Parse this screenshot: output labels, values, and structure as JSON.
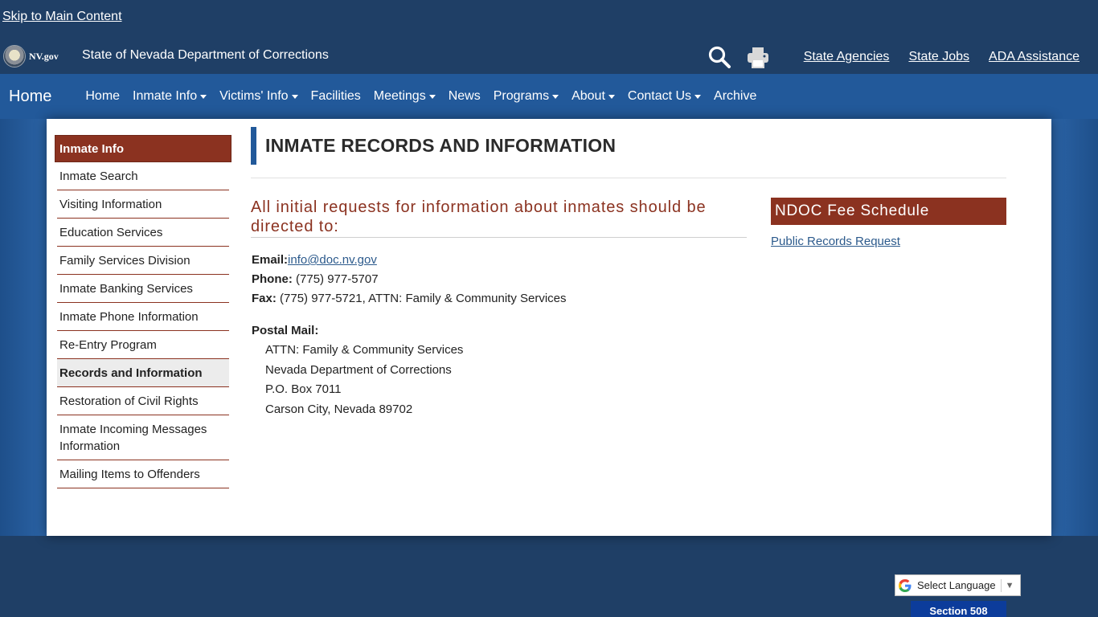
{
  "skip_link": "Skip to Main Content",
  "header": {
    "nvgov": "NV.gov",
    "agency": "State of Nevada Department of Corrections",
    "links": [
      "State Agencies",
      "State Jobs",
      "ADA Assistance"
    ]
  },
  "nav": {
    "brand": "Home",
    "items": [
      {
        "label": "Home",
        "dropdown": false
      },
      {
        "label": "Inmate Info",
        "dropdown": true
      },
      {
        "label": "Victims' Info",
        "dropdown": true
      },
      {
        "label": "Facilities",
        "dropdown": false
      },
      {
        "label": "Meetings",
        "dropdown": true
      },
      {
        "label": "News",
        "dropdown": false
      },
      {
        "label": "Programs",
        "dropdown": true
      },
      {
        "label": "About",
        "dropdown": true
      },
      {
        "label": "Contact Us",
        "dropdown": true
      },
      {
        "label": "Archive",
        "dropdown": false
      }
    ]
  },
  "sidebar": {
    "heading": "Inmate Info",
    "items": [
      "Inmate Search",
      "Visiting Information",
      "Education Services",
      "Family Services Division",
      "Inmate Banking Services",
      "Inmate Phone Information",
      "Re-Entry Program",
      "Records and Information",
      "Restoration of Civil Rights",
      "Inmate Incoming Messages Information",
      "Mailing Items to Offenders"
    ],
    "active_index": 7
  },
  "main": {
    "title": "INMATE RECORDS AND INFORMATION",
    "lead": "All initial requests for information about inmates should be directed to:",
    "email_label": "Email:",
    "email": "info@doc.nv.gov",
    "phone_label": "Phone:",
    "phone": " (775) 977-5707",
    "fax_label": "Fax:",
    "fax": " (775) 977-5721, ATTN: Family & Community Services",
    "postal_label": "Postal Mail:",
    "postal_lines": [
      "ATTN: Family & Community Services",
      "Nevada Department of Corrections",
      "P.O. Box 7011",
      "Carson City, Nevada 89702"
    ]
  },
  "aside": {
    "heading": "NDOC Fee Schedule",
    "link": "Public Records Request"
  },
  "footer": {
    "language": "Select Language",
    "section508": "Section 508"
  },
  "colors": {
    "header_bg": "#1f3f66",
    "nav_bg": "#22599a",
    "accent": "#8b3220",
    "link": "#2c5a8c"
  }
}
